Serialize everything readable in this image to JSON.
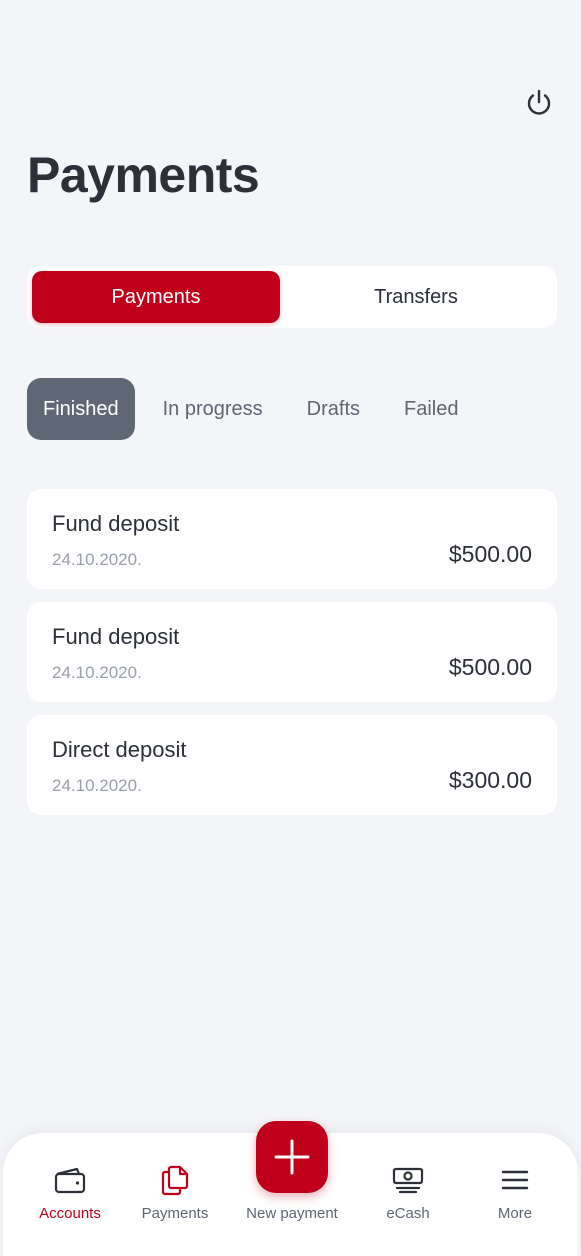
{
  "header": {
    "title": "Payments",
    "power_icon": "power-icon"
  },
  "segmented": {
    "options": [
      "Payments",
      "Transfers"
    ],
    "selected": "Payments"
  },
  "filters": {
    "options": [
      "Finished",
      "In progress",
      "Drafts",
      "Failed"
    ],
    "selected": "Finished"
  },
  "transactions": [
    {
      "title": "Fund deposit",
      "date": "24.10.2020.",
      "amount": "$500.00"
    },
    {
      "title": "Fund deposit",
      "date": "24.10.2020.",
      "amount": "$500.00"
    },
    {
      "title": "Direct deposit",
      "date": "24.10.2020.",
      "amount": "$300.00"
    }
  ],
  "tabbar": {
    "items": [
      {
        "label": "Accounts",
        "icon": "wallet-icon",
        "active": true
      },
      {
        "label": "Payments",
        "icon": "documents-icon",
        "active": false
      },
      {
        "label": "New payment",
        "icon": "plus-icon",
        "active": false
      },
      {
        "label": "eCash",
        "icon": "cash-icon",
        "active": false
      },
      {
        "label": "More",
        "icon": "menu-icon",
        "active": false
      }
    ]
  },
  "colors": {
    "accent": "#c0001b",
    "background": "#f4f5f9",
    "chip_active": "#5f6775",
    "text": "#2b3039",
    "muted": "#9aa0ab"
  }
}
